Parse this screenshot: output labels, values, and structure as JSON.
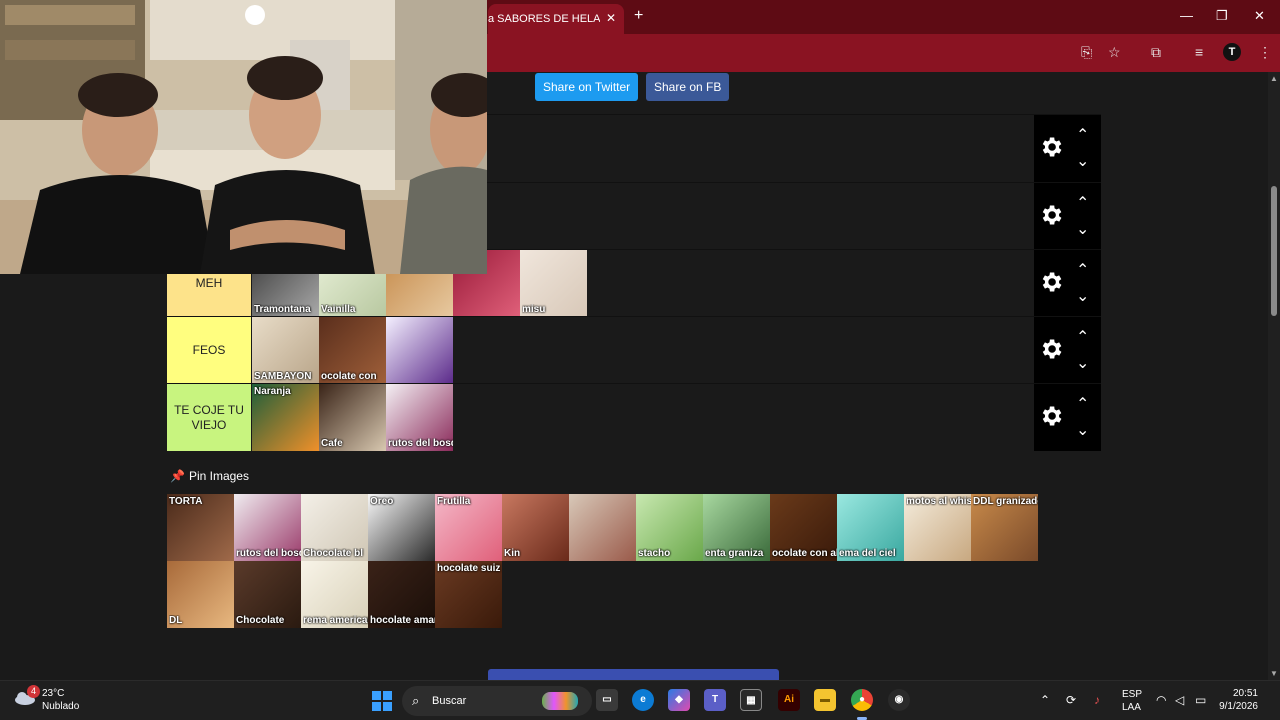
{
  "browser": {
    "tab_title": "a SABORES DE HELADO",
    "close_glyph": "✕",
    "new_tab_glyph": "+",
    "window_controls": [
      "—",
      "❐",
      "✕"
    ],
    "toolbar_icons": [
      "translate-icon",
      "star-icon",
      "extensions-icon",
      "media-icon",
      "profile-avatar",
      "menu-icon"
    ],
    "avatar_letter": "T"
  },
  "share": {
    "twitter_label": "Share on Twitter",
    "fb_label": "Share on FB"
  },
  "tiers": [
    {
      "label": "",
      "color": "#1a1a1a",
      "items": []
    },
    {
      "label": "",
      "color": "#1a1a1a",
      "items": []
    },
    {
      "label": "MEH",
      "color": "#fde38a",
      "items": [
        {
          "caption": "Tramontana",
          "bg": "linear-gradient(135deg,#3b3b3b,#a9a9a9)"
        },
        {
          "caption": "Vainilla",
          "bg": "linear-gradient(135deg,#e8f0d8,#b8c8a0)"
        },
        {
          "caption": "",
          "bg": "linear-gradient(135deg,#c58a4a,#e7c9a0)"
        },
        {
          "caption": "",
          "bg": "linear-gradient(135deg,#9a1b3a,#e0607a)"
        },
        {
          "caption": "misu",
          "bg": "linear-gradient(135deg,#f0e6dc,#d8c8b8)"
        }
      ]
    },
    {
      "label": "FEOS",
      "color": "#fffe7f",
      "items": [
        {
          "caption": "SAMBAYÓN",
          "bg": "linear-gradient(135deg,#e8dcc8,#b8a488)"
        },
        {
          "caption": "ocolate con",
          "bg": "linear-gradient(135deg,#5a2e1c,#a0603a)"
        },
        {
          "caption": "",
          "bg": "linear-gradient(135deg,#f4f0ff,#5b2a8a)"
        }
      ]
    },
    {
      "label": "TE COJE TU VIEJO",
      "color": "#c8f47f",
      "items": [
        {
          "caption": "Naranja",
          "bg": "linear-gradient(135deg,#1d5e3a,#f0902a)",
          "cap_top": true
        },
        {
          "caption": "Cafe",
          "bg": "linear-gradient(135deg,#3a2418,#d8c8b0)"
        },
        {
          "caption": "rutos del bosqu",
          "bg": "linear-gradient(135deg,#f4f0f4,#8a2a5a)"
        }
      ]
    }
  ],
  "pool": {
    "title": "Pin Images",
    "pin_glyph": "📌",
    "items": [
      {
        "caption": "TORTA",
        "bg": "linear-gradient(135deg,#4a2a1a,#a06a4a)",
        "cap_top": true
      },
      {
        "caption": "rutos del bosque",
        "bg": "linear-gradient(135deg,#f0ecf0,#9a3a6a)"
      },
      {
        "caption": "Chocolate bl",
        "bg": "linear-gradient(135deg,#f4f0e8,#cfc6b4)"
      },
      {
        "caption": "Oreo",
        "bg": "linear-gradient(135deg,#f8f8f8,#2a2a2a)",
        "cap_top": true
      },
      {
        "caption": "Frutilla",
        "bg": "linear-gradient(135deg,#f4b8c8,#e0607a)",
        "cap_top": true
      },
      {
        "caption": "Kin",
        "bg": "linear-gradient(135deg,#c87860,#6a2a1a)"
      },
      {
        "caption": "",
        "bg": "linear-gradient(135deg,#d8c8b8,#9a5a4a)"
      },
      {
        "caption": "stacho",
        "bg": "linear-gradient(135deg,#c8e8b0,#6aa84a)"
      },
      {
        "caption": "enta graniza",
        "bg": "linear-gradient(135deg,#a8d8a0,#3a6a3a)"
      },
      {
        "caption": "ocolate con almend",
        "bg": "linear-gradient(135deg,#6a3a1a,#3a1a0a)"
      },
      {
        "caption": "ema del ciel",
        "bg": "linear-gradient(135deg,#9ae8e0,#3aa8a0)"
      },
      {
        "caption": "motos al whis",
        "bg": "linear-gradient(135deg,#f4ecdc,#c8a880)",
        "cap_top": true
      },
      {
        "caption": "DDL granizado",
        "bg": "linear-gradient(135deg,#c88a4a,#7a4a2a)",
        "cap_top": true
      },
      {
        "caption": "DL",
        "bg": "linear-gradient(135deg,#a86a3a,#e8b880)"
      },
      {
        "caption": "Chocolate",
        "bg": "linear-gradient(135deg,#5a3a2a,#2a1a10)"
      },
      {
        "caption": "rema american",
        "bg": "linear-gradient(135deg,#f8f4e8,#d8d0b8)"
      },
      {
        "caption": "hocolate amarg",
        "bg": "linear-gradient(135deg,#3a2218,#1a0e08)"
      },
      {
        "caption": "hocolate suiz",
        "bg": "linear-gradient(135deg,#6a3a22,#3a1a0a)",
        "cap_top": true
      }
    ]
  },
  "taskbar": {
    "weather_temp": "23°C",
    "weather_desc": "Nublado",
    "weather_badge": "4",
    "search_placeholder": "Buscar",
    "lang_line1": "ESP",
    "lang_line2": "LAA",
    "time": "20:51",
    "date": "9/1/2026",
    "apps": [
      "task-view",
      "edge",
      "copilot",
      "teams",
      "store",
      "illustrator",
      "file-explorer",
      "chrome",
      "obs"
    ]
  },
  "colors": {
    "titlebar": "#5e0b14",
    "toolbar": "#8a1322",
    "page_bg": "#1a1a1a"
  }
}
